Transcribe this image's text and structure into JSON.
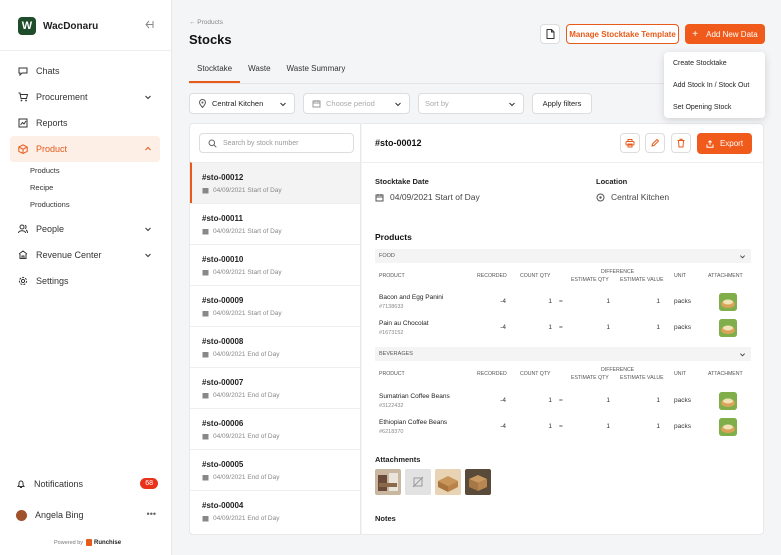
{
  "app": {
    "name": "WacDonaru",
    "logo_letter": "W"
  },
  "sidebar": {
    "items": [
      {
        "label": "Chats",
        "icon": "chat-icon"
      },
      {
        "label": "Procurement",
        "icon": "cart-icon"
      },
      {
        "label": "Reports",
        "icon": "chart-icon"
      },
      {
        "label": "Product",
        "icon": "box-icon"
      },
      {
        "label": "People",
        "icon": "people-icon"
      },
      {
        "label": "Revenue Center",
        "icon": "revenue-icon"
      },
      {
        "label": "Settings",
        "icon": "gear-icon"
      }
    ],
    "product_sub": [
      "Products",
      "Recipe",
      "Productions"
    ],
    "notifications_label": "Notifications",
    "notifications_count": "68",
    "user_name": "Angela Bing",
    "powered_by": "Powered by",
    "powered_brand": "Runchise"
  },
  "header": {
    "breadcrumb": "← Products",
    "title": "Stocks",
    "template_button": "Manage Stocktake Template",
    "add_button": "Add New Data",
    "add_plus": "+"
  },
  "tabs": [
    "Stocktake",
    "Waste",
    "Waste Summary"
  ],
  "menu": [
    "Create Stocktake",
    "Add Stock In / Stock Out",
    "Set Opening Stock"
  ],
  "filters": {
    "location": "Central Kitchen",
    "period_placeholder": "Choose period",
    "sort_placeholder": "Sort by",
    "apply": "Apply filters"
  },
  "list": {
    "search_placeholder": "Search by stock number",
    "items": [
      {
        "num": "#sto-00012",
        "date": "04/09/2021 Start of Day"
      },
      {
        "num": "#sto-00011",
        "date": "04/09/2021 Start of Day"
      },
      {
        "num": "#sto-00010",
        "date": "04/09/2021 Start of Day"
      },
      {
        "num": "#sto-00009",
        "date": "04/09/2021 Start of Day"
      },
      {
        "num": "#sto-00008",
        "date": "04/09/2021 End of Day"
      },
      {
        "num": "#sto-00007",
        "date": "04/09/2021 End of Day"
      },
      {
        "num": "#sto-00006",
        "date": "04/09/2021 End of Day"
      },
      {
        "num": "#sto-00005",
        "date": "04/09/2021 End of Day"
      },
      {
        "num": "#sto-00004",
        "date": "04/09/2021 End of Day"
      }
    ]
  },
  "detail": {
    "title": "#sto-00012",
    "export": "Export",
    "date_label": "Stocktake Date",
    "date_value": "04/09/2021 Start of Day",
    "location_label": "Location",
    "location_value": "Central Kitchen",
    "products_title": "Products",
    "columns": {
      "product": "PRODUCT",
      "recorded": "RECORDED",
      "count_qty": "COUNT QTY",
      "difference": "DIFFERENCE",
      "estimate_qty": "ESTIMATE QTY",
      "estimate_value": "ESTIMATE VALUE",
      "unit": "UNIT",
      "attachment": "ATTACHMENT"
    },
    "groups": [
      {
        "name": "FOOD",
        "rows": [
          {
            "name": "Bacon and Egg Panini",
            "code": "#7138633",
            "recorded": "-4",
            "count": "1",
            "eq": "=",
            "est_qty": "1",
            "est_val": "1",
            "unit": "packs"
          },
          {
            "name": "Pain au Chocolat",
            "code": "#1673152",
            "recorded": "-4",
            "count": "1",
            "eq": "=",
            "est_qty": "1",
            "est_val": "1",
            "unit": "packs"
          }
        ]
      },
      {
        "name": "BEVERAGES",
        "rows": [
          {
            "name": "Sumatrian Coffee Beans",
            "code": "#3122432",
            "recorded": "-4",
            "count": "1",
            "eq": "=",
            "est_qty": "1",
            "est_val": "1",
            "unit": "packs"
          },
          {
            "name": "Ethiopian Coffee Beans",
            "code": "#6218370",
            "recorded": "-4",
            "count": "1",
            "eq": "=",
            "est_qty": "1",
            "est_val": "1",
            "unit": "packs"
          }
        ]
      }
    ],
    "attachments_title": "Attachments",
    "notes_title": "Notes"
  },
  "colors": {
    "accent": "#F05A1A",
    "brand": "#1F4D2B",
    "badge": "#E8321A"
  }
}
